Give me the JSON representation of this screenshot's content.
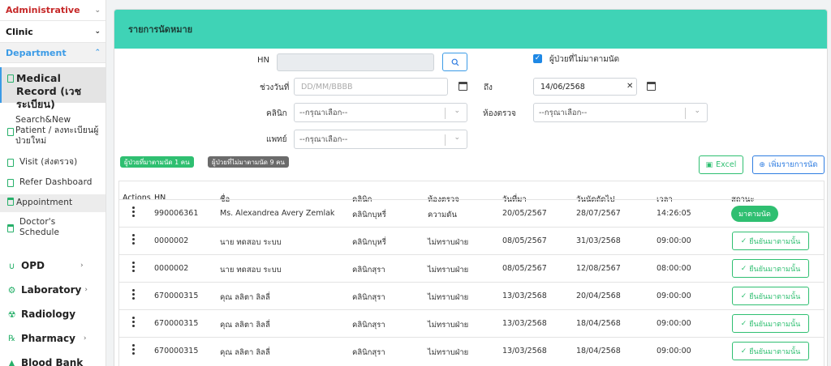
{
  "sidebar": {
    "administrative": "Administrative",
    "clinic": "Clinic",
    "department": "Department",
    "items": [
      {
        "label": "Medical Record (เวชระเบียน)"
      },
      {
        "label": "Search&New Patient / ลงทะเบียนผู้ป่วยใหม่"
      },
      {
        "label": "Visit (ส่งตรวจ)"
      },
      {
        "label": "Refer Dashboard"
      },
      {
        "label": "Appointment"
      },
      {
        "label": "Doctor's Schedule"
      }
    ],
    "groups": [
      {
        "label": "OPD"
      },
      {
        "label": "Laboratory"
      },
      {
        "label": "Radiology"
      },
      {
        "label": "Pharmacy"
      },
      {
        "label": "Blood Bank"
      }
    ]
  },
  "panel": {
    "title": "รายการนัดหมาย"
  },
  "filters": {
    "hn_label": "HN",
    "hn_value": "",
    "absent_checkbox_label": "ผู้ป่วยที่ไม่มาตามนัด",
    "absent_checked": true,
    "date_range_label": "ช่วงวันที่",
    "date_from_placeholder": "DD/MM/BBBB",
    "to_label": "ถึง",
    "date_to_value": "14/06/2568",
    "clinic_label": "คลินิก",
    "clinic_value": "--กรุณาเลือก--",
    "room_label": "ห้องตรวจ",
    "room_value": "--กรุณาเลือก--",
    "doctor_label": "แพทย์",
    "doctor_value": "--กรุณาเลือก--"
  },
  "badges": {
    "attended": "ผู้ป่วยที่มาตามนัด 1 คน",
    "absent": "ผู้ป่วยที่ไม่มาตามนัด 9 คน"
  },
  "actions": {
    "excel": "Excel",
    "add": "เพิ่มรายการนัด"
  },
  "table": {
    "headers": [
      "Actions",
      "HN",
      "ชื่อ",
      "คลินิก",
      "ห้องตรวจ",
      "วันที่มา",
      "วันนัดถัดไป",
      "เวลา",
      "สถานะ"
    ],
    "rows": [
      {
        "hn": "990006361",
        "name": "Ms. Alexandrea Avery Zemlak",
        "clinic": "คลินิกบุหรี่",
        "room": "ความดัน",
        "visit": "20/05/2567",
        "next": "28/07/2567",
        "time": "14:26:05",
        "status": "มาตามนัด",
        "status_type": "pill"
      },
      {
        "hn": "0000002",
        "name": "นาย ทดสอบ ระบบ",
        "clinic": "คลินิกบุหรี่",
        "room": "ไม่ทราบฝ่าย",
        "visit": "08/05/2567",
        "next": "31/03/2568",
        "time": "09:00:00",
        "status": "ยืนยันมาตามนั้น",
        "status_type": "button"
      },
      {
        "hn": "0000002",
        "name": "นาย ทดสอบ ระบบ",
        "clinic": "คลินิกสุรา",
        "room": "ไม่ทราบฝ่าย",
        "visit": "08/05/2567",
        "next": "12/08/2567",
        "time": "08:00:00",
        "status": "ยืนยันมาตามนั้น",
        "status_type": "button"
      },
      {
        "hn": "670000315",
        "name": "คุณ ลลิตา ลิลลี่",
        "clinic": "คลินิกสุรา",
        "room": "ไม่ทราบฝ่าย",
        "visit": "13/03/2568",
        "next": "20/04/2568",
        "time": "09:00:00",
        "status": "ยืนยันมาตามนั้น",
        "status_type": "button"
      },
      {
        "hn": "670000315",
        "name": "คุณ ลลิตา ลิลลี่",
        "clinic": "คลินิกสุรา",
        "room": "ไม่ทราบฝ่าย",
        "visit": "13/03/2568",
        "next": "18/04/2568",
        "time": "09:00:00",
        "status": "ยืนยันมาตามนั้น",
        "status_type": "button"
      },
      {
        "hn": "670000315",
        "name": "คุณ ลลิตา ลิลลี่",
        "clinic": "คลินิกสุรา",
        "room": "ไม่ทราบฝ่าย",
        "visit": "13/03/2568",
        "next": "18/04/2568",
        "time": "09:00:00",
        "status": "ยืนยันมาตามนั้น",
        "status_type": "button"
      }
    ]
  },
  "colors": {
    "header_bg": "#3fd3b6",
    "accent_green": "#2fbf71",
    "accent_blue": "#2f7de1",
    "admin_red": "#c62828",
    "dept_blue": "#3b9be6"
  }
}
